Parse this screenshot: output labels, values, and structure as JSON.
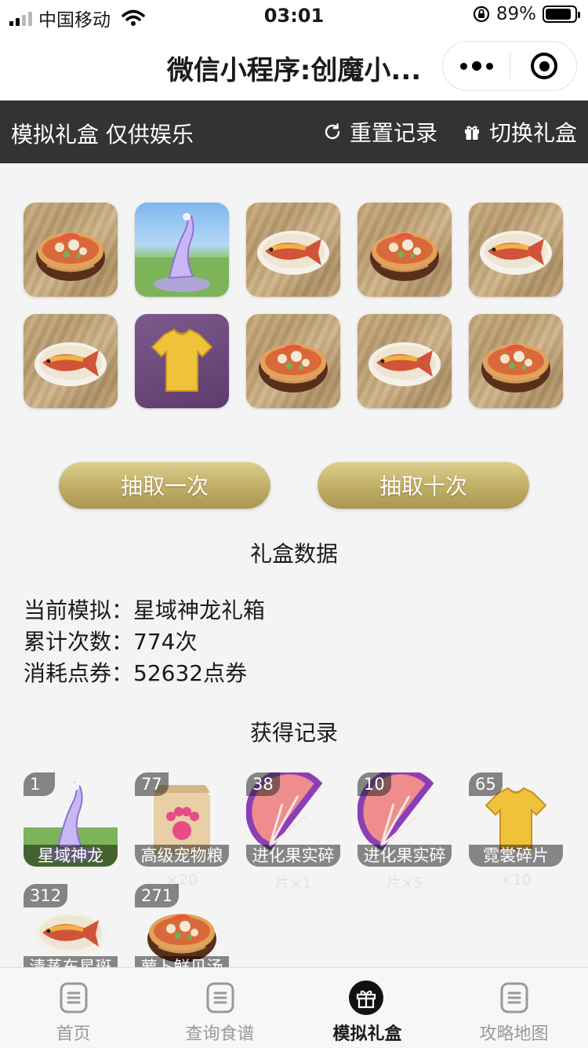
{
  "status_bar": {
    "carrier": "中国移动",
    "time": "03:01",
    "battery_percent": "89%",
    "battery_level": 0.89
  },
  "nav": {
    "title": "微信小程序:创魔小..."
  },
  "toolbar": {
    "label": "模拟礼盒 仅供娱乐",
    "reset_label": "重置记录",
    "switch_label": "切换礼盒"
  },
  "prize_grid": [
    {
      "item": "soup",
      "icon": "shellfish-soup-icon"
    },
    {
      "item": "dragon",
      "icon": "star-dragon-icon"
    },
    {
      "item": "fish",
      "icon": "steamed-fish-icon"
    },
    {
      "item": "soup",
      "icon": "shellfish-soup-icon"
    },
    {
      "item": "fish",
      "icon": "steamed-fish-icon"
    },
    {
      "item": "fish",
      "icon": "steamed-fish-icon"
    },
    {
      "item": "shirt",
      "icon": "yellow-shirt-icon"
    },
    {
      "item": "soup",
      "icon": "shellfish-soup-icon"
    },
    {
      "item": "fish",
      "icon": "steamed-fish-icon"
    },
    {
      "item": "soup",
      "icon": "shellfish-soup-icon"
    }
  ],
  "buttons": {
    "draw_once": "抽取一次",
    "draw_ten": "抽取十次"
  },
  "stats": {
    "title": "礼盒数据",
    "current_label": "当前模拟：",
    "current_value": "星域神龙礼箱",
    "count_label": "累计次数：",
    "count_value": "774次",
    "cost_label": "消耗点券：",
    "cost_value": "52632点券"
  },
  "records": {
    "title": "获得记录",
    "items": [
      {
        "count": "1",
        "name": "星域神龙",
        "sub": "",
        "icon": "star-dragon-icon"
      },
      {
        "count": "77",
        "name": "高级宠物粮",
        "sub": "×20",
        "icon": "pet-food-bag-icon"
      },
      {
        "count": "38",
        "name": "进化果实碎",
        "sub": "片×1",
        "icon": "evolution-fruit-icon"
      },
      {
        "count": "10",
        "name": "进化果实碎",
        "sub": "片×5",
        "icon": "evolution-fruit-icon"
      },
      {
        "count": "65",
        "name": "霓裳碎片",
        "sub": "×10",
        "icon": "yellow-shirt-icon"
      },
      {
        "count": "312",
        "name": "清蒸东星斑",
        "sub": "",
        "icon": "steamed-fish-icon"
      },
      {
        "count": "271",
        "name": "萝卜鲜贝汤",
        "sub": "",
        "icon": "shellfish-soup-icon"
      }
    ]
  },
  "tabs": [
    {
      "label": "首页",
      "icon": "home-doc-icon",
      "active": false
    },
    {
      "label": "查询食谱",
      "icon": "recipe-doc-icon",
      "active": false
    },
    {
      "label": "模拟礼盒",
      "icon": "gift-icon",
      "active": true
    },
    {
      "label": "攻略地图",
      "icon": "map-doc-icon",
      "active": false
    }
  ]
}
